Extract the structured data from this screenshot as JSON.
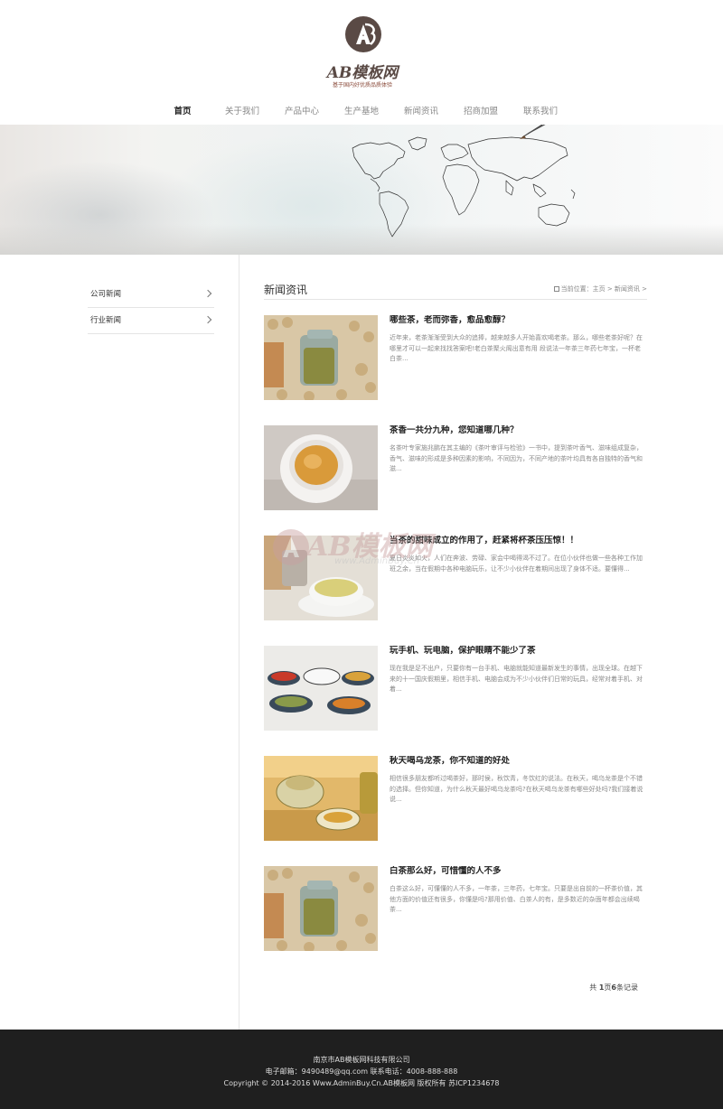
{
  "brand": {
    "name": "AB模板网",
    "slogan": "基于国内好优质品质体验"
  },
  "nav": {
    "items": [
      "首页",
      "关于我们",
      "产品中心",
      "生产基地",
      "新闻资讯",
      "招商加盟",
      "联系我们"
    ],
    "active": "首页"
  },
  "sidebar": {
    "items": [
      "公司新闻",
      "行业新闻"
    ]
  },
  "main": {
    "title": "新闻资讯",
    "breadcrumb": "当前位置：主页 > 新闻资讯 >"
  },
  "articles": [
    {
      "title": "哪些茶，老而弥香，愈品愈醇？",
      "summary": "近年来，老茶渐渐受到大众的追捧，越来越多人开始喜欢喝老茶。那么，哪些老茶好呢？在哪里才可以一起来找找答案吧!老白茶聚火阁出意有用 段说法一年茶三年药七年宝，一杯老白茶..."
    },
    {
      "title": "茶香一共分九种，您知道哪几种？",
      "summary": "名茶叶专家施兆鹏在其主编的《茶叶审评与检验》一书中，提到茶叶香气、滋味组成复杂，香气、滋味的形成是多种因素的影响，不同因为，不同产地的茶叶均具有各自独特的香气和滋..."
    },
    {
      "title": "当茶的甜味成立的作用了，赶紧将杯茶压压惊！！",
      "summary": "夏日炎炎如火，人们在奔波、劳碌、家会中喝得渴不过了。在位小伙伴也做一些各种工作加班之余，当在假期中各种电脑玩乐，让不少小伙伴在着期间出现了身体不适。要懂得..."
    },
    {
      "title": "玩手机、玩电脑，保护眼睛不能少了茶",
      "summary": "现在我是足不出户，只要你有一台手机、电脑就能知道最新发生的事情，出现全球。在越下来的十一国庆假期里，相信手机、电脑会成为不少小伙伴们日常的玩具，经常对着手机、对着..."
    },
    {
      "title": "秋天喝乌龙茶，你不知道的好处",
      "summary": "相信很多朋友都听过喝茶好，那时侯，秋饮青，冬饮红的说法。在秋天，喝乌龙茶是个不错的选择。但你知道，为什么秋天最好喝乌龙茶吗?在秋天喝乌龙茶有哪些好处吗?我们接着说说..."
    },
    {
      "title": "白茶那么好，可惜懂的人不多",
      "summary": "白茶这么好，可懂懂的人不多，一年茶，三年药，七年宝。只要是出自前的一杯茶价值，其他方面的价值还有很多，你懂是吗?那用价值、白茶人的有，是多数近的杂面年都会出续喝茶..."
    }
  ],
  "pager": {
    "prefix": "共",
    "pages": "1",
    "mid": "页",
    "records": "6",
    "suffix": "条记录"
  },
  "watermark": {
    "text": "AB模板网",
    "url": "www.AdminBuy.Cn"
  },
  "footer": {
    "company": "南京市AB模板网科技有限公司",
    "contact": "电子邮箱：9490489@qq.com    联系电话：4008-888-888",
    "copyright": "Copyright © 2014-2016 Www.AdminBuy.Cn.AB模板网 版权所有    苏ICP1234678"
  }
}
